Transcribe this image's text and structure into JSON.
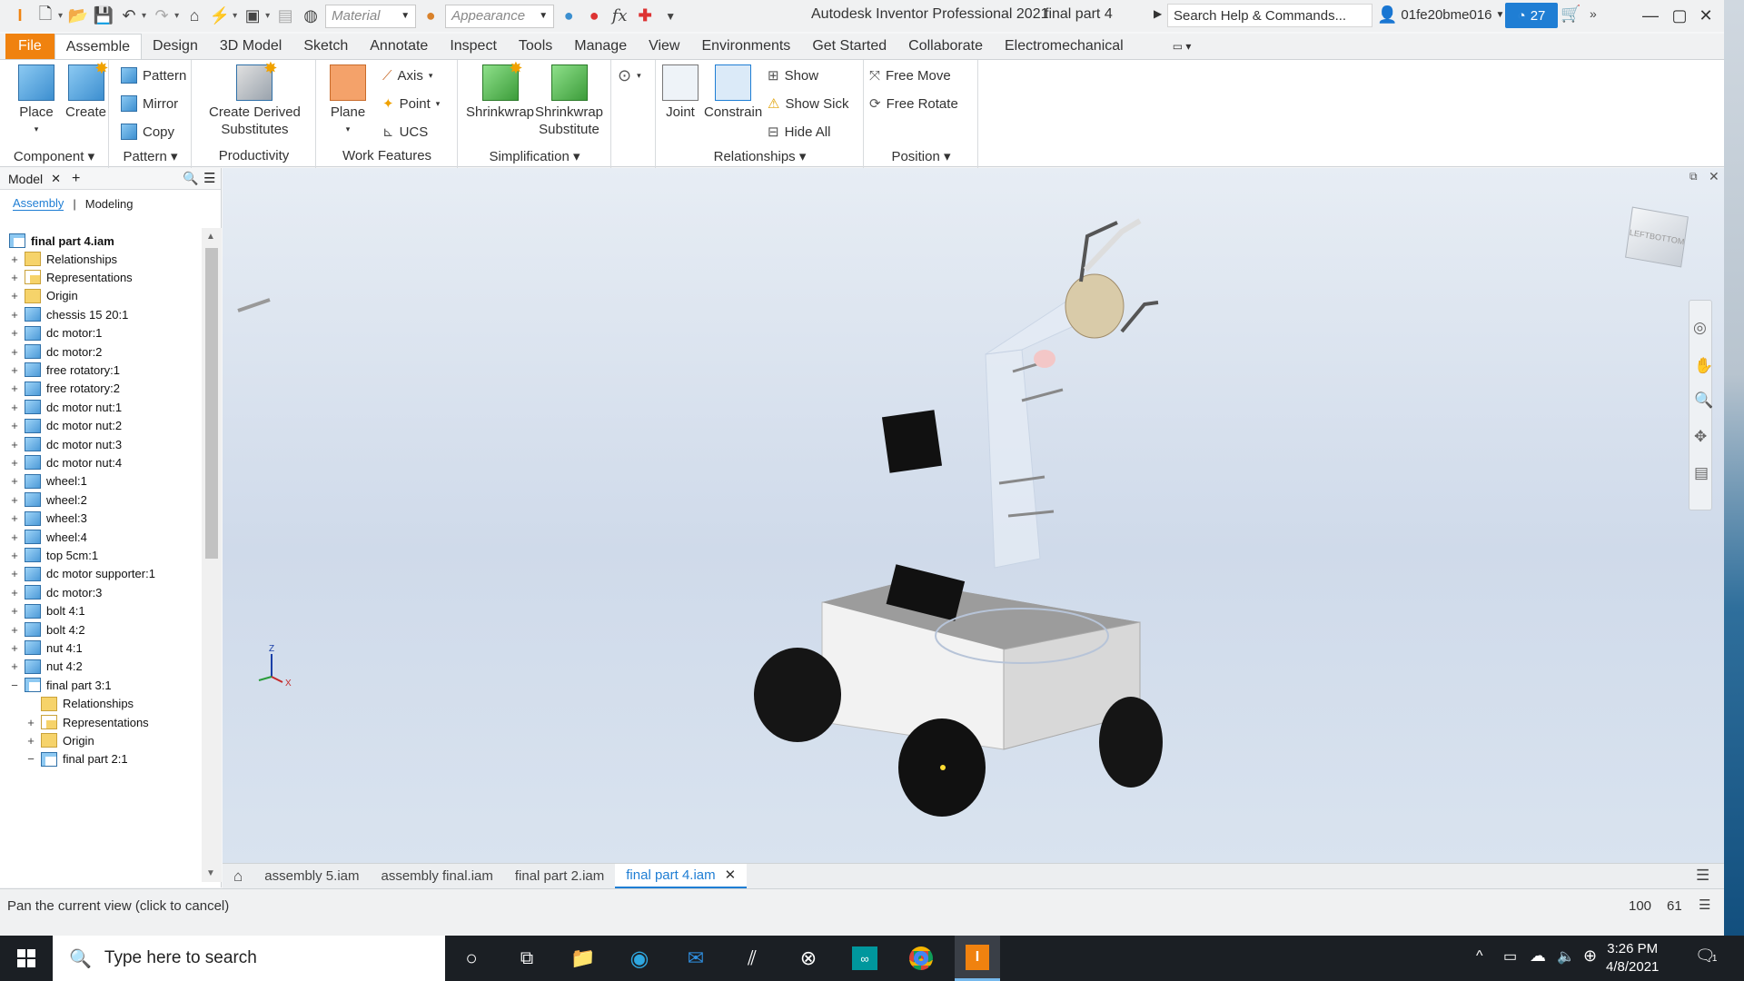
{
  "titlebar": {
    "app_title": "Autodesk Inventor Professional 2021",
    "doc_title": "final part 4",
    "material_placeholder": "Material",
    "appearance_placeholder": "Appearance",
    "search_placeholder": "Search Help & Commands...",
    "user": "01fe20bme016",
    "trial_count": "27"
  },
  "ribbon_tabs": [
    "File",
    "Assemble",
    "Design",
    "3D Model",
    "Sketch",
    "Annotate",
    "Inspect",
    "Tools",
    "Manage",
    "View",
    "Environments",
    "Get Started",
    "Collaborate",
    "Electromechanical"
  ],
  "ribbon": {
    "component": {
      "title": "Component",
      "place": "Place",
      "create": "Create"
    },
    "pattern": {
      "title": "Pattern",
      "pattern": "Pattern",
      "mirror": "Mirror",
      "copy": "Copy"
    },
    "productivity": {
      "title": "Productivity",
      "create_derived_1": "Create Derived",
      "create_derived_2": "Substitutes"
    },
    "work_features": {
      "title": "Work Features",
      "plane": "Plane",
      "axis": "Axis",
      "point": "Point",
      "ucs": "UCS"
    },
    "simplification": {
      "title": "Simplification",
      "shrinkwrap": "Shrinkwrap",
      "shrinkwrap_sub_1": "Shrinkwrap",
      "shrinkwrap_sub_2": "Substitute"
    },
    "relationships": {
      "title": "Relationships",
      "joint": "Joint",
      "constrain": "Constrain",
      "show": "Show",
      "show_sick": "Show Sick",
      "hide_all": "Hide All"
    },
    "position": {
      "title": "Position",
      "free_move": "Free Move",
      "free_rotate": "Free Rotate"
    }
  },
  "browser": {
    "tab_label": "Model",
    "subtab_assembly": "Assembly",
    "subtab_modeling": "Modeling",
    "root": "final part 4.iam",
    "items": [
      {
        "label": "Relationships",
        "icon": "folder",
        "toggle": "+",
        "indent": 0
      },
      {
        "label": "Representations",
        "icon": "repr",
        "toggle": "+",
        "indent": 0
      },
      {
        "label": "Origin",
        "icon": "folder",
        "toggle": "+",
        "indent": 0
      },
      {
        "label": "chessis 15 20:1",
        "icon": "part",
        "toggle": "+",
        "indent": 0
      },
      {
        "label": "dc motor:1",
        "icon": "part",
        "toggle": "+",
        "indent": 0
      },
      {
        "label": "dc motor:2",
        "icon": "part",
        "toggle": "+",
        "indent": 0
      },
      {
        "label": "free rotatory:1",
        "icon": "part",
        "toggle": "+",
        "indent": 0
      },
      {
        "label": "free rotatory:2",
        "icon": "part",
        "toggle": "+",
        "indent": 0
      },
      {
        "label": "dc motor nut:1",
        "icon": "part",
        "toggle": "+",
        "indent": 0
      },
      {
        "label": "dc motor nut:2",
        "icon": "part",
        "toggle": "+",
        "indent": 0
      },
      {
        "label": "dc motor nut:3",
        "icon": "part",
        "toggle": "+",
        "indent": 0
      },
      {
        "label": "dc motor nut:4",
        "icon": "part",
        "toggle": "+",
        "indent": 0
      },
      {
        "label": "wheel:1",
        "icon": "part",
        "toggle": "+",
        "indent": 0
      },
      {
        "label": "wheel:2",
        "icon": "part",
        "toggle": "+",
        "indent": 0
      },
      {
        "label": "wheel:3",
        "icon": "part",
        "toggle": "+",
        "indent": 0
      },
      {
        "label": "wheel:4",
        "icon": "part",
        "toggle": "+",
        "indent": 0
      },
      {
        "label": "top 5cm:1",
        "icon": "part",
        "toggle": "+",
        "indent": 0
      },
      {
        "label": "dc motor supporter:1",
        "icon": "part",
        "toggle": "+",
        "indent": 0
      },
      {
        "label": "dc motor:3",
        "icon": "part",
        "toggle": "+",
        "indent": 0
      },
      {
        "label": "bolt 4:1",
        "icon": "part",
        "toggle": "+",
        "indent": 0
      },
      {
        "label": "bolt 4:2",
        "icon": "part",
        "toggle": "+",
        "indent": 0
      },
      {
        "label": "nut 4:1",
        "icon": "part",
        "toggle": "+",
        "indent": 0
      },
      {
        "label": "nut 4:2",
        "icon": "part",
        "toggle": "+",
        "indent": 0
      },
      {
        "label": "final part 3:1",
        "icon": "asm",
        "toggle": "−",
        "indent": 0
      },
      {
        "label": "Relationships",
        "icon": "folder",
        "toggle": "",
        "indent": 1
      },
      {
        "label": "Representations",
        "icon": "repr",
        "toggle": "+",
        "indent": 1
      },
      {
        "label": "Origin",
        "icon": "folder",
        "toggle": "+",
        "indent": 1
      },
      {
        "label": "final part 2:1",
        "icon": "asm",
        "toggle": "−",
        "indent": 1
      }
    ]
  },
  "viewcube_label": "LEFT",
  "viewcube_label2": "BOTTOM",
  "triad": {
    "x": "X",
    "z": "Z"
  },
  "doc_tabs": [
    "assembly 5.iam",
    "assembly final.iam",
    "final part 2.iam",
    "final part 4.iam"
  ],
  "active_doc_tab": "final part 4.iam",
  "status": {
    "text": "Pan the current view (click to cancel)",
    "num1": "100",
    "num2": "61"
  },
  "taskbar": {
    "search_placeholder": "Type here to search",
    "time": "3:26 PM",
    "date": "4/8/2021",
    "notif_count": "1"
  }
}
